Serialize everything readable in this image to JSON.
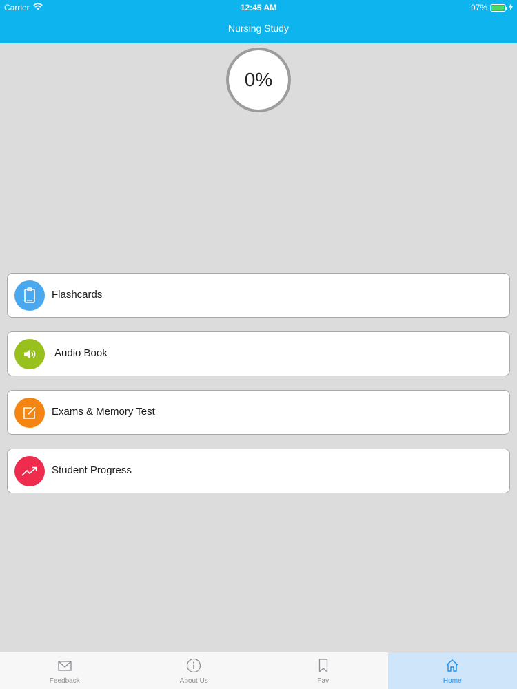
{
  "status_bar": {
    "carrier": "Carrier",
    "time": "12:45 AM",
    "battery": "97%",
    "battery_level": 0.97
  },
  "header": {
    "title": "Nursing Study",
    "background_color": "#0db4ee"
  },
  "progress": {
    "label": "0%",
    "value": 0
  },
  "menu": {
    "items": [
      {
        "label": "Flashcards",
        "icon": "clipboard-icon",
        "color": "#4aa9ee"
      },
      {
        "label": "Audio Book",
        "icon": "speaker-icon",
        "color": "#98c11d"
      },
      {
        "label": "Exams & Memory Test",
        "icon": "edit-icon",
        "color": "#f58512"
      },
      {
        "label": "Student Progress",
        "icon": "trending-up-icon",
        "color": "#ef2b4e"
      }
    ]
  },
  "tabbar": {
    "tabs": [
      {
        "label": "Feedback",
        "icon": "envelope-icon",
        "active": false
      },
      {
        "label": "About Us",
        "icon": "info-icon",
        "active": false
      },
      {
        "label": "Fav",
        "icon": "bookmark-icon",
        "active": false
      },
      {
        "label": "Home",
        "icon": "home-icon",
        "active": true
      }
    ]
  }
}
